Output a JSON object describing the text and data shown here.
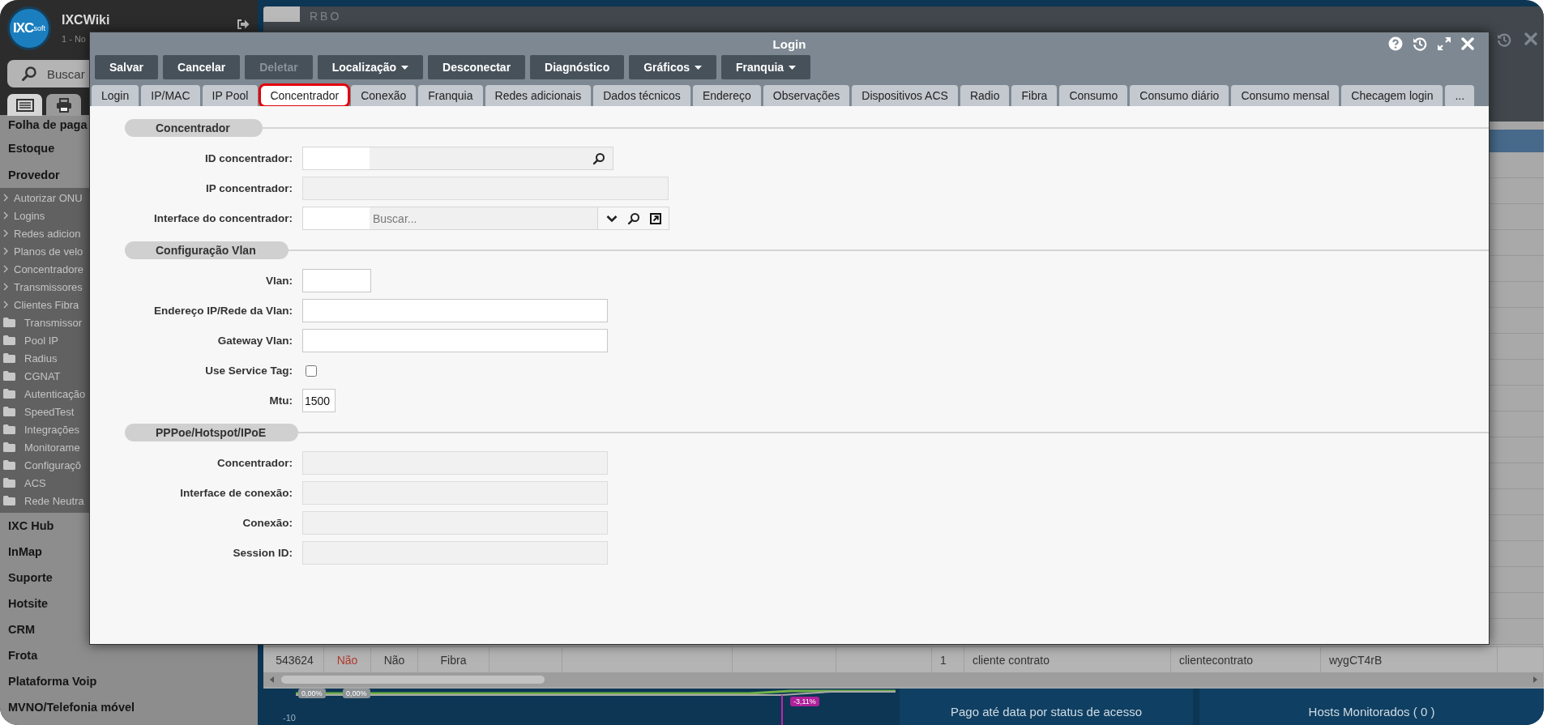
{
  "sidebar": {
    "logo": {
      "text": "IXC",
      "suffix": "soft"
    },
    "title": "IXCWiki",
    "subtitle": "1 - No",
    "search": {
      "placeholder": "Buscar"
    },
    "icon_tabs": [
      {
        "kind": "list",
        "selected": true
      },
      {
        "kind": "print",
        "selected": false
      }
    ],
    "menu_top": [
      "Folha de paga",
      "Estoque",
      "Provedor"
    ],
    "submenu": [
      {
        "label": "Autorizar ONU",
        "kind": "link"
      },
      {
        "label": "Logins",
        "kind": "link"
      },
      {
        "label": "Redes adicion",
        "kind": "link"
      },
      {
        "label": "Planos de velo",
        "kind": "link"
      },
      {
        "label": "Concentradore",
        "kind": "link"
      },
      {
        "label": "Transmissores",
        "kind": "link"
      },
      {
        "label": "Clientes Fibra",
        "kind": "link"
      },
      {
        "label": "Transmissor",
        "kind": "folder"
      },
      {
        "label": "Pool IP",
        "kind": "folder"
      },
      {
        "label": "Radius",
        "kind": "folder"
      },
      {
        "label": "CGNAT",
        "kind": "folder"
      },
      {
        "label": "Autenticação",
        "kind": "folder"
      },
      {
        "label": "SpeedTest",
        "kind": "folder"
      },
      {
        "label": "Integrações",
        "kind": "folder"
      },
      {
        "label": "Monitorame",
        "kind": "folder"
      },
      {
        "label": "Configuraçõ",
        "kind": "folder"
      },
      {
        "label": "ACS",
        "kind": "folder"
      },
      {
        "label": "Rede Neutra",
        "kind": "folder"
      }
    ],
    "menu_bottom": [
      "IXC Hub",
      "InMap",
      "Suporte",
      "Hotsite",
      "CRM",
      "Frota",
      "Plataforma Voip",
      "MVNO/Telefonia móvel"
    ]
  },
  "background_window": {
    "title": "RBO",
    "row": [
      {
        "text": "543624",
        "color": "#333333"
      },
      {
        "text": "Não",
        "color": "#b03a2e"
      },
      {
        "text": "Não",
        "color": "#333333"
      },
      {
        "text": "Fibra",
        "color": "#333333"
      },
      {
        "text": "1",
        "color": "#333333"
      },
      {
        "text": "cliente contrato",
        "color": "#333333"
      },
      {
        "text": "clientecontrato",
        "color": "#333333"
      },
      {
        "text": "wygCT4rB",
        "color": "#333333"
      }
    ]
  },
  "dashboard": {
    "chart_labels": [
      "0,00%",
      "0,00%",
      "-3,11%"
    ],
    "axis_label": "-10",
    "panels": [
      "Pago até data por status de acesso",
      "Hosts Monitorados ( 0 )"
    ]
  },
  "modal": {
    "title": "Login",
    "toolbar": [
      {
        "label": "Salvar",
        "disabled": false,
        "dropdown": false
      },
      {
        "label": "Cancelar",
        "disabled": false,
        "dropdown": false
      },
      {
        "label": "Deletar",
        "disabled": true,
        "dropdown": false
      },
      {
        "label": "Localização",
        "disabled": false,
        "dropdown": true
      },
      {
        "label": "Desconectar",
        "disabled": false,
        "dropdown": false
      },
      {
        "label": "Diagnóstico",
        "disabled": false,
        "dropdown": false
      },
      {
        "label": "Gráficos",
        "disabled": false,
        "dropdown": true
      },
      {
        "label": "Franquia",
        "disabled": false,
        "dropdown": true
      }
    ],
    "tabs": [
      {
        "label": "Login",
        "selected": false
      },
      {
        "label": "IP/MAC",
        "selected": false
      },
      {
        "label": "IP Pool",
        "selected": false
      },
      {
        "label": "Concentrador",
        "selected": true
      },
      {
        "label": "Conexão",
        "selected": false
      },
      {
        "label": "Franquia",
        "selected": false
      },
      {
        "label": "Redes adicionais",
        "selected": false
      },
      {
        "label": "Dados técnicos",
        "selected": false
      },
      {
        "label": "Endereço",
        "selected": false
      },
      {
        "label": "Observações",
        "selected": false
      },
      {
        "label": "Dispositivos ACS",
        "selected": false
      },
      {
        "label": "Radio",
        "selected": false
      },
      {
        "label": "Fibra",
        "selected": false
      },
      {
        "label": "Consumo",
        "selected": false
      },
      {
        "label": "Consumo diário",
        "selected": false
      },
      {
        "label": "Consumo mensal",
        "selected": false
      },
      {
        "label": "Checagem login",
        "selected": false
      },
      {
        "label": "...",
        "selected": false
      }
    ],
    "sections": [
      {
        "title": "Concentrador",
        "fields": [
          {
            "label": "ID concentrador:",
            "kind": "lookup"
          },
          {
            "label": "IP concentrador:",
            "kind": "wide",
            "disabled": true
          },
          {
            "label": "Interface do concentrador:",
            "kind": "lookup-select",
            "placeholder": "Buscar..."
          }
        ]
      },
      {
        "title": "Configuração Vlan",
        "fields": [
          {
            "label": "Vlan:",
            "kind": "short",
            "disabled": false
          },
          {
            "label": "Endereço IP/Rede da Vlan:",
            "kind": "text",
            "disabled": false
          },
          {
            "label": "Gateway Vlan:",
            "kind": "text",
            "disabled": false
          },
          {
            "label": "Use Service Tag:",
            "kind": "checkbox",
            "checked": false
          },
          {
            "label": "Mtu:",
            "kind": "number",
            "disabled": false,
            "value": "1500"
          }
        ]
      },
      {
        "title": "PPPoe/Hotspot/IPoE",
        "fields": [
          {
            "label": "Concentrador:",
            "kind": "text",
            "disabled": true
          },
          {
            "label": "Interface de conexão:",
            "kind": "text",
            "disabled": true
          },
          {
            "label": "Conexão:",
            "kind": "text",
            "disabled": true
          },
          {
            "label": "Session ID:",
            "kind": "text",
            "disabled": true
          }
        ]
      }
    ]
  }
}
